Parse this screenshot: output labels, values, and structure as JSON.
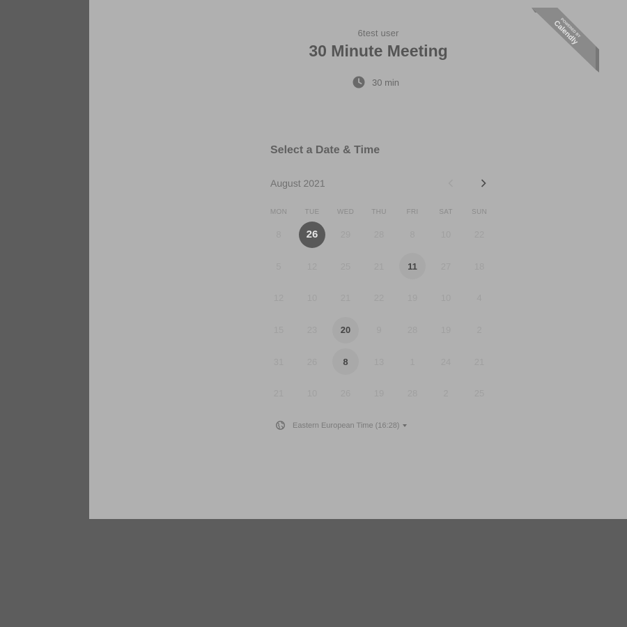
{
  "event": {
    "host_name": "6test user",
    "title": "30 Minute Meeting",
    "duration": "30 min"
  },
  "badge": {
    "line1": "POWERED BY",
    "line2": "Calendly"
  },
  "scheduler": {
    "heading": "Select a Date & Time",
    "month": "August 2021",
    "weekdays": [
      "MON",
      "TUE",
      "WED",
      "THU",
      "FRI",
      "SAT",
      "SUN"
    ],
    "days": [
      {
        "label": "8",
        "state": "disabled"
      },
      {
        "label": "26",
        "state": "selected"
      },
      {
        "label": "29",
        "state": "disabled"
      },
      {
        "label": "28",
        "state": "disabled"
      },
      {
        "label": "8",
        "state": "disabled"
      },
      {
        "label": "10",
        "state": "disabled"
      },
      {
        "label": "22",
        "state": "disabled"
      },
      {
        "label": "5",
        "state": "disabled"
      },
      {
        "label": "12",
        "state": "disabled"
      },
      {
        "label": "25",
        "state": "disabled"
      },
      {
        "label": "21",
        "state": "disabled"
      },
      {
        "label": "11",
        "state": "available"
      },
      {
        "label": "27",
        "state": "disabled"
      },
      {
        "label": "18",
        "state": "disabled"
      },
      {
        "label": "12",
        "state": "disabled"
      },
      {
        "label": "10",
        "state": "disabled"
      },
      {
        "label": "21",
        "state": "disabled"
      },
      {
        "label": "22",
        "state": "disabled"
      },
      {
        "label": "19",
        "state": "disabled"
      },
      {
        "label": "10",
        "state": "disabled"
      },
      {
        "label": "4",
        "state": "disabled"
      },
      {
        "label": "15",
        "state": "disabled"
      },
      {
        "label": "23",
        "state": "disabled"
      },
      {
        "label": "20",
        "state": "available"
      },
      {
        "label": "9",
        "state": "disabled"
      },
      {
        "label": "28",
        "state": "disabled"
      },
      {
        "label": "19",
        "state": "disabled"
      },
      {
        "label": "2",
        "state": "disabled"
      },
      {
        "label": "31",
        "state": "disabled"
      },
      {
        "label": "26",
        "state": "disabled"
      },
      {
        "label": "8",
        "state": "available"
      },
      {
        "label": "13",
        "state": "disabled"
      },
      {
        "label": "1",
        "state": "disabled"
      },
      {
        "label": "24",
        "state": "disabled"
      },
      {
        "label": "21",
        "state": "disabled"
      },
      {
        "label": "21",
        "state": "disabled"
      },
      {
        "label": "10",
        "state": "disabled"
      },
      {
        "label": "26",
        "state": "disabled"
      },
      {
        "label": "19",
        "state": "disabled"
      },
      {
        "label": "28",
        "state": "disabled"
      },
      {
        "label": "2",
        "state": "disabled"
      },
      {
        "label": "25",
        "state": "disabled"
      }
    ],
    "timezone": "Eastern European Time (16:28)"
  },
  "icons": {
    "duration": "clock-icon",
    "prev": "chevron-left-icon",
    "next": "chevron-right-icon",
    "timezone": "globe-icon",
    "dropdown": "caret-down-icon"
  },
  "colors": {
    "page_background": "#5d5d5d",
    "panel_background": "#b0b0b0",
    "selected_day": "#595959",
    "available_day": "#a9a9a9",
    "badge": "#8a8a8a"
  }
}
